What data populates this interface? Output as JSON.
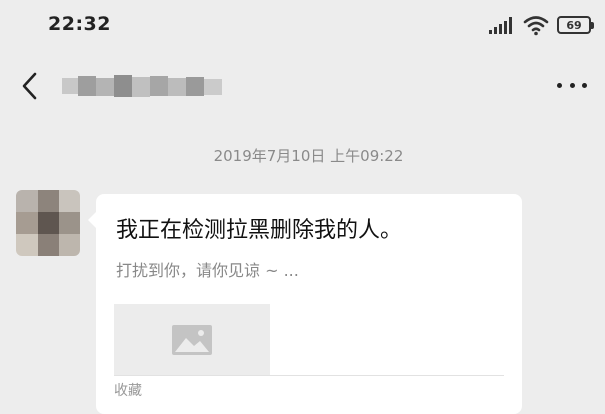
{
  "status_bar": {
    "time": "22:32",
    "battery_level": "69",
    "icons": [
      "signal-icon",
      "wifi-icon",
      "battery-icon"
    ]
  },
  "nav": {
    "back_icon": "chevron-left-icon",
    "contact_name_blurred": true,
    "more_icon": "more-horizontal-icon"
  },
  "chat": {
    "timestamp": "2019年7月10日 上午09:22",
    "message": {
      "sender_avatar_blurred": true,
      "type": "link-card",
      "title": "我正在检测拉黑删除我的人。",
      "description": "打扰到你，请你见谅 ~ ...",
      "thumbnail_icon": "image-placeholder-icon",
      "source_label": "收藏"
    }
  },
  "colors": {
    "background": "#ededed",
    "bubble": "#ffffff",
    "secondary_text": "#888888"
  }
}
